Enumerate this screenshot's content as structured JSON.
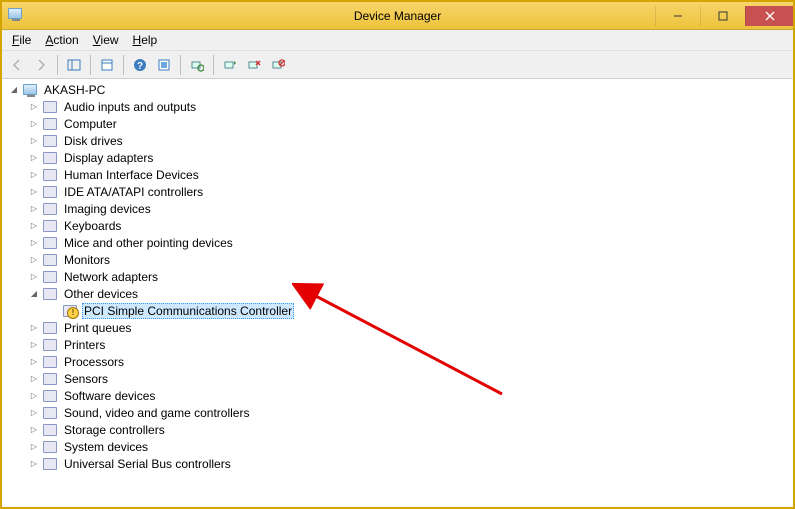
{
  "window": {
    "title": "Device Manager"
  },
  "menu": {
    "file": "File",
    "action": "Action",
    "view": "View",
    "help": "Help"
  },
  "toolbar": {
    "back": "Back",
    "forward": "Forward",
    "show_hide_tree": "Show/Hide Console Tree",
    "properties": "Properties",
    "help": "Help",
    "refresh": "Refresh",
    "scan": "Scan for hardware changes",
    "update_driver": "Update Driver Software",
    "uninstall": "Uninstall",
    "disable": "Disable"
  },
  "tree": {
    "root": "AKASH-PC",
    "nodes": [
      {
        "label": "Audio inputs and outputs",
        "expanded": false
      },
      {
        "label": "Computer",
        "expanded": false
      },
      {
        "label": "Disk drives",
        "expanded": false
      },
      {
        "label": "Display adapters",
        "expanded": false
      },
      {
        "label": "Human Interface Devices",
        "expanded": false
      },
      {
        "label": "IDE ATA/ATAPI controllers",
        "expanded": false
      },
      {
        "label": "Imaging devices",
        "expanded": false
      },
      {
        "label": "Keyboards",
        "expanded": false
      },
      {
        "label": "Mice and other pointing devices",
        "expanded": false
      },
      {
        "label": "Monitors",
        "expanded": false
      },
      {
        "label": "Network adapters",
        "expanded": false
      },
      {
        "label": "Other devices",
        "expanded": true,
        "children": [
          {
            "label": "PCI Simple Communications Controller",
            "warning": true,
            "selected": true
          }
        ]
      },
      {
        "label": "Print queues",
        "expanded": false
      },
      {
        "label": "Printers",
        "expanded": false
      },
      {
        "label": "Processors",
        "expanded": false
      },
      {
        "label": "Sensors",
        "expanded": false
      },
      {
        "label": "Software devices",
        "expanded": false
      },
      {
        "label": "Sound, video and game controllers",
        "expanded": false
      },
      {
        "label": "Storage controllers",
        "expanded": false
      },
      {
        "label": "System devices",
        "expanded": false
      },
      {
        "label": "Universal Serial Bus controllers",
        "expanded": false
      }
    ]
  }
}
